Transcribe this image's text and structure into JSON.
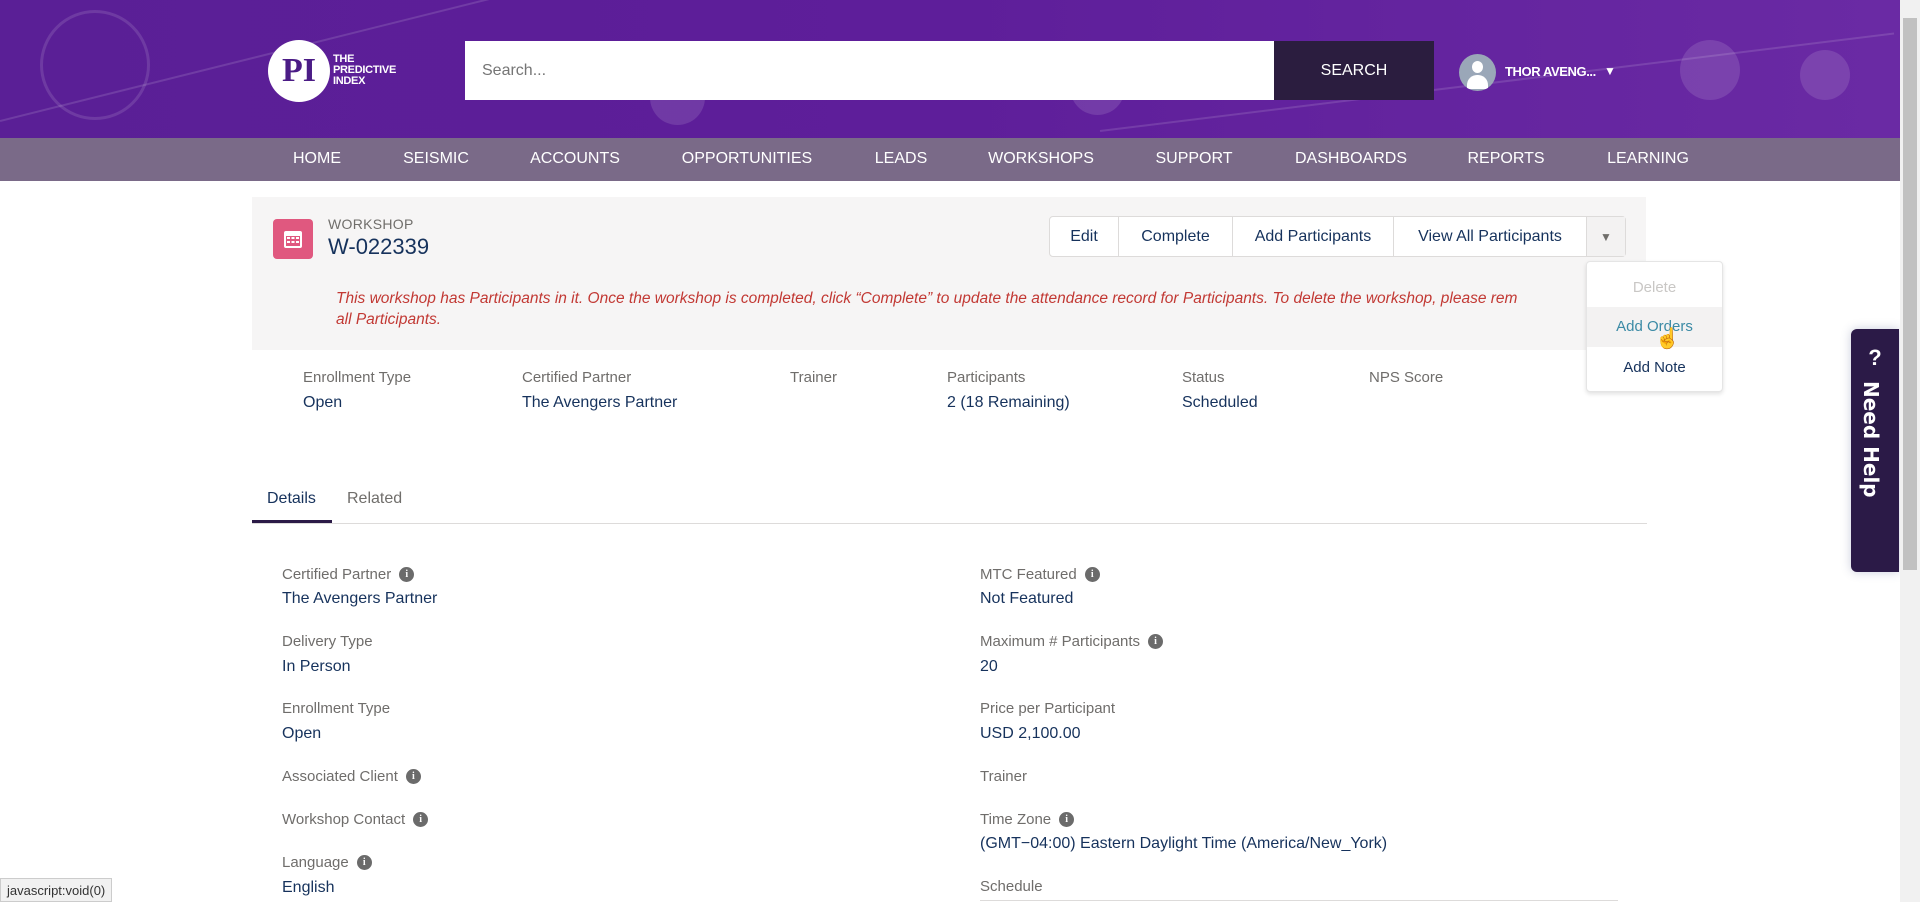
{
  "header": {
    "logo_text": "THE PREDICTIVE INDEX",
    "logo_mark": "PI",
    "search_placeholder": "Search...",
    "search_button": "SEARCH",
    "user_name": "THOR AVENG...",
    "brand_color": "#5a1f96"
  },
  "nav": [
    "HOME",
    "SEISMIC",
    "ACCOUNTS",
    "OPPORTUNITIES",
    "LEADS",
    "WORKSHOPS",
    "SUPPORT",
    "DASHBOARDS",
    "REPORTS",
    "LEARNING"
  ],
  "record": {
    "type_label": "WORKSHOP",
    "title": "W-022339",
    "actions": [
      "Edit",
      "Complete",
      "Add Participants",
      "View All Participants"
    ],
    "menu": [
      "Delete",
      "Add Orders",
      "Add Note"
    ],
    "warning_line1": "This workshop has Participants in it. Once the workshop is completed, click “Complete” to update the attendance record for Participants. To delete the workshop, please rem",
    "warning_line2": "all Participants.",
    "highlights": [
      {
        "label": "Enrollment Type",
        "value": "Open"
      },
      {
        "label": "Certified Partner",
        "value": "The Avengers Partner"
      },
      {
        "label": "Trainer",
        "value": ""
      },
      {
        "label": "Participants",
        "value": "2 (18 Remaining)"
      },
      {
        "label": "Status",
        "value": "Scheduled"
      },
      {
        "label": "NPS Score",
        "value": ""
      }
    ]
  },
  "tabs": [
    "Details",
    "Related"
  ],
  "details": {
    "left": [
      {
        "label": "Certified Partner",
        "value": "The Avengers Partner"
      },
      {
        "label": "Delivery Type",
        "value": "In Person"
      },
      {
        "label": "Enrollment Type",
        "value": "Open"
      },
      {
        "label": "Associated Client",
        "value": ""
      },
      {
        "label": "Workshop Contact",
        "value": ""
      },
      {
        "label": "Language",
        "value": "English"
      }
    ],
    "right": [
      {
        "label": "MTC Featured",
        "value": "Not Featured"
      },
      {
        "label": "Maximum # Participants",
        "value": "20"
      },
      {
        "label": "Price per Participant",
        "value": "USD 2,100.00"
      },
      {
        "label": "Trainer",
        "value": ""
      },
      {
        "label": "Time Zone",
        "value": "(GMT−04:00) Eastern Daylight Time (America/New_York)"
      },
      {
        "label": "Schedule",
        "value": ""
      }
    ]
  },
  "help": {
    "icon": "?",
    "label": "Need Help"
  },
  "status_bar": "javascript:void(0)"
}
